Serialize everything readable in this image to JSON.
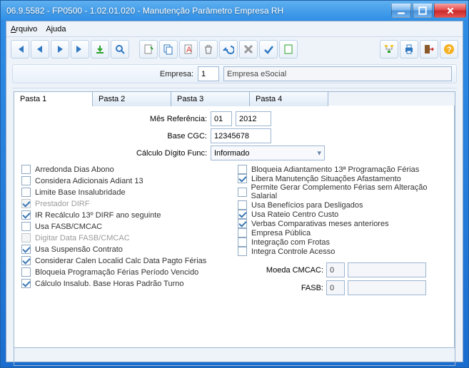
{
  "window": {
    "title": "06.9.5582 - FP0500 - 1.02.01.020 - Manutenção Parâmetro Empresa RH"
  },
  "menubar": {
    "file": "Arquivo",
    "help": "Ajuda"
  },
  "header": {
    "empresa_label": "Empresa:",
    "empresa_code": "1",
    "empresa_name": "Empresa eSocial"
  },
  "tabs": [
    "Pasta 1",
    "Pasta 2",
    "Pasta 3",
    "Pasta 4"
  ],
  "fields": {
    "mes_ref_label": "Mês Referência:",
    "mes_ref_m": "01",
    "mes_ref_y": "2012",
    "base_cgc_label": "Base CGC:",
    "base_cgc": "12345678",
    "calc_dig_label": "Cálculo Dígito Func:",
    "calc_dig": "Informado"
  },
  "left_checks": [
    {
      "label": "Arredonda Dias Abono",
      "checked": false,
      "dim": false
    },
    {
      "label": "Considera Adicionais Adiant 13",
      "checked": false,
      "dim": false
    },
    {
      "label": "Limite Base Insalubridade",
      "checked": false,
      "dim": false
    },
    {
      "label": "Prestador DIRF",
      "checked": true,
      "dim": true
    },
    {
      "label": "IR Recálculo 13º DIRF ano seguinte",
      "checked": true,
      "dim": false
    },
    {
      "label": "Usa FASB/CMCAC",
      "checked": false,
      "dim": false
    },
    {
      "label": "Digitar Data FASB/CMCAC",
      "checked": false,
      "dim": true
    },
    {
      "label": "Usa Suspensão Contrato",
      "checked": true,
      "dim": false
    },
    {
      "label": "Considerar Calen Localid Calc Data Pagto Férias",
      "checked": true,
      "dim": false
    },
    {
      "label": "Bloqueia Programação Férias Período Vencido",
      "checked": false,
      "dim": false
    },
    {
      "label": "Cálculo Insalub. Base Horas Padrão Turno",
      "checked": true,
      "dim": false
    }
  ],
  "right_checks": [
    {
      "label": "Bloqueia Adiantamento 13ª Programação Férias",
      "checked": false,
      "dim": false
    },
    {
      "label": "Libera Manutenção Situações Afastamento",
      "checked": true,
      "dim": false
    },
    {
      "label": "Permite Gerar Complemento Férias sem Alteração Salarial",
      "checked": false,
      "dim": false
    },
    {
      "label": "Usa Benefícios para Desligados",
      "checked": false,
      "dim": false
    },
    {
      "label": "Usa Rateio Centro Custo",
      "checked": true,
      "dim": false
    },
    {
      "label": "Verbas Comparativas meses anteriores",
      "checked": true,
      "dim": false
    },
    {
      "label": "Empresa Pública",
      "checked": false,
      "dim": false
    },
    {
      "label": "Integração com Frotas",
      "checked": false,
      "dim": false
    },
    {
      "label": "Integra Controle Acesso",
      "checked": false,
      "dim": false
    }
  ],
  "right_values": {
    "moeda_label": "Moeda CMCAC:",
    "moeda_code": "0",
    "moeda_text": "",
    "fasb_label": "FASB:",
    "fasb_code": "0",
    "fasb_text": ""
  },
  "icons": {
    "first": "first",
    "prev": "prev",
    "next": "next",
    "last": "last",
    "undo": "undo",
    "search": "search",
    "new": "new",
    "copy": "copy",
    "rename": "rename",
    "delete": "delete",
    "revert": "revert",
    "cancel": "cancel",
    "confirm": "confirm",
    "blank": "blank",
    "tree": "tree",
    "print": "print",
    "exit": "exit",
    "help": "help"
  }
}
